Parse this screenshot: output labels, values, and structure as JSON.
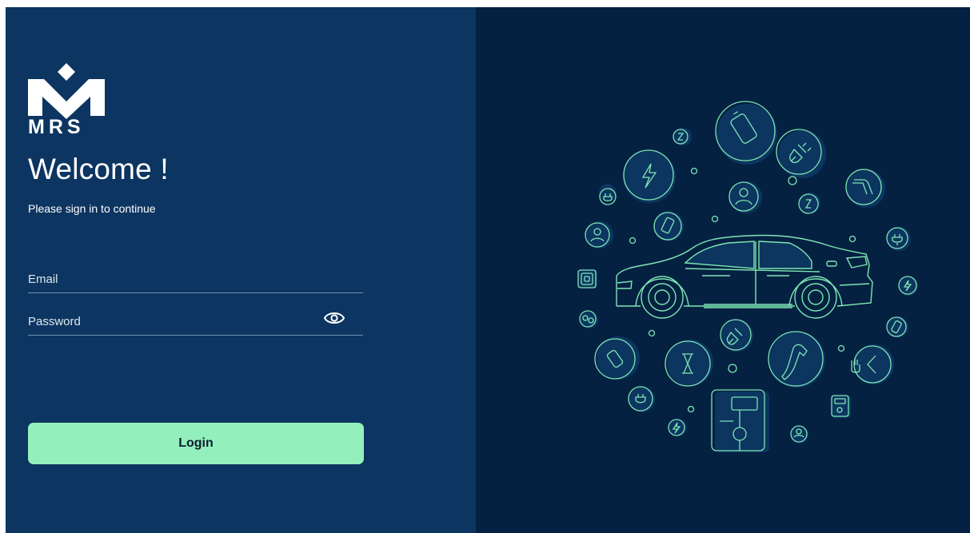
{
  "brand": {
    "logo_text": "MRS"
  },
  "login": {
    "heading": "Welcome !",
    "subtitle": "Please sign in to continue",
    "email": {
      "placeholder": "Email",
      "value": ""
    },
    "password": {
      "placeholder": "Password",
      "value": ""
    },
    "submit_label": "Login"
  },
  "theme": {
    "left_panel": "#0d3561",
    "right_panel": "#052142",
    "accent": "#93efbc",
    "line_art": "#7ee6b4"
  },
  "illustration": {
    "subject": "electric car surrounded by EV charging icons",
    "icons": [
      "battery-icon",
      "lightning-icon",
      "plug-icon",
      "user-icon",
      "hourglass-icon",
      "charger-nozzle-icon",
      "charging-station-icon",
      "nfc-card-icon",
      "car-icon"
    ]
  }
}
